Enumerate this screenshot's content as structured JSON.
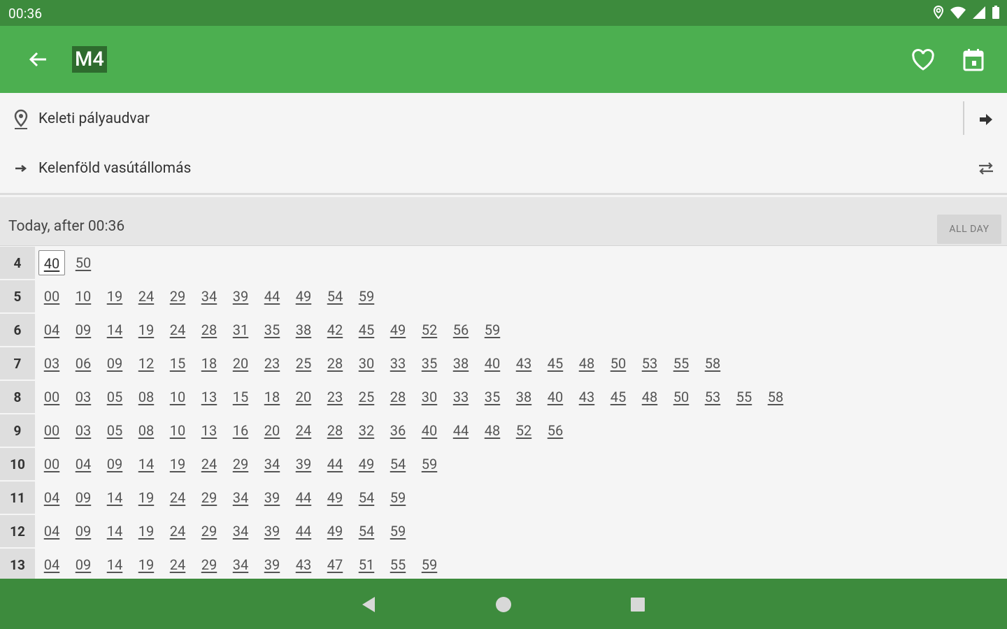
{
  "status_bar": {
    "time": "00:36",
    "icons": [
      "location-icon",
      "wifi-icon",
      "signal-icon",
      "battery-icon"
    ]
  },
  "app_bar": {
    "route": "M4",
    "back_icon": "arrow-left-icon",
    "favorite_icon": "heart-outline-icon",
    "calendar_icon": "calendar-icon"
  },
  "stops": {
    "from": "Keleti pályaudvar",
    "to": "Kelenföld vasútállomás"
  },
  "day_bar": {
    "label": "Today, after 00:36",
    "all_day_button": "ALL DAY"
  },
  "timetable": {
    "selected": {
      "hour": "4",
      "minute": "40"
    },
    "rows": [
      {
        "hour": "4",
        "minutes": [
          "40",
          "50"
        ]
      },
      {
        "hour": "5",
        "minutes": [
          "00",
          "10",
          "19",
          "24",
          "29",
          "34",
          "39",
          "44",
          "49",
          "54",
          "59"
        ]
      },
      {
        "hour": "6",
        "minutes": [
          "04",
          "09",
          "14",
          "19",
          "24",
          "28",
          "31",
          "35",
          "38",
          "42",
          "45",
          "49",
          "52",
          "56",
          "59"
        ]
      },
      {
        "hour": "7",
        "minutes": [
          "03",
          "06",
          "09",
          "12",
          "15",
          "18",
          "20",
          "23",
          "25",
          "28",
          "30",
          "33",
          "35",
          "38",
          "40",
          "43",
          "45",
          "48",
          "50",
          "53",
          "55",
          "58"
        ]
      },
      {
        "hour": "8",
        "minutes": [
          "00",
          "03",
          "05",
          "08",
          "10",
          "13",
          "15",
          "18",
          "20",
          "23",
          "25",
          "28",
          "30",
          "33",
          "35",
          "38",
          "40",
          "43",
          "45",
          "48",
          "50",
          "53",
          "55",
          "58"
        ]
      },
      {
        "hour": "9",
        "minutes": [
          "00",
          "03",
          "05",
          "08",
          "10",
          "13",
          "16",
          "20",
          "24",
          "28",
          "32",
          "36",
          "40",
          "44",
          "48",
          "52",
          "56"
        ]
      },
      {
        "hour": "10",
        "minutes": [
          "00",
          "04",
          "09",
          "14",
          "19",
          "24",
          "29",
          "34",
          "39",
          "44",
          "49",
          "54",
          "59"
        ]
      },
      {
        "hour": "11",
        "minutes": [
          "04",
          "09",
          "14",
          "19",
          "24",
          "29",
          "34",
          "39",
          "44",
          "49",
          "54",
          "59"
        ]
      },
      {
        "hour": "12",
        "minutes": [
          "04",
          "09",
          "14",
          "19",
          "24",
          "29",
          "34",
          "39",
          "44",
          "49",
          "54",
          "59"
        ]
      },
      {
        "hour": "13",
        "minutes": [
          "04",
          "09",
          "14",
          "19",
          "24",
          "29",
          "34",
          "39",
          "43",
          "47",
          "51",
          "55",
          "59"
        ]
      }
    ]
  },
  "nav_bar": {
    "buttons": [
      "back-triangle-icon",
      "home-circle-icon",
      "recents-square-icon"
    ]
  },
  "colors": {
    "status_bar": "#3d8b3d",
    "app_bar": "#4caf50",
    "route_badge": "#2e6b2e",
    "nav_bar": "#3d8b3d"
  }
}
